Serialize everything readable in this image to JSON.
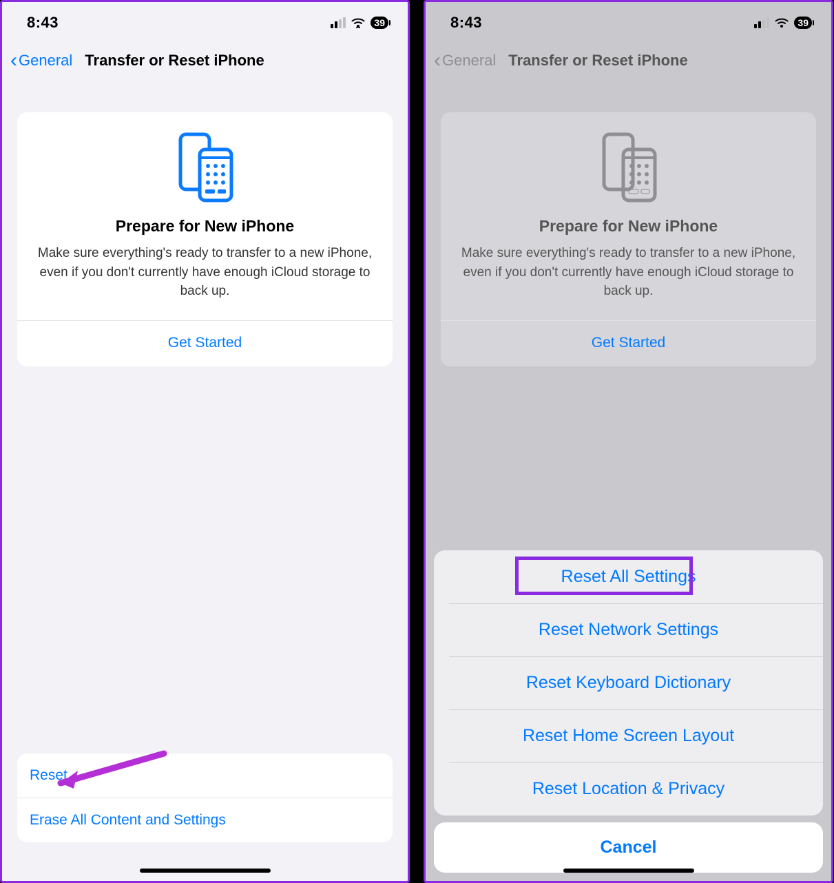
{
  "status": {
    "time": "8:43",
    "battery": "39"
  },
  "nav": {
    "back": "General",
    "title": "Transfer or Reset iPhone"
  },
  "card": {
    "title": "Prepare for New iPhone",
    "desc": "Make sure everything's ready to transfer to a new iPhone, even if you don't currently have enough iCloud storage to back up.",
    "cta": "Get Started"
  },
  "bottom": {
    "reset": "Reset",
    "erase": "Erase All Content and Settings"
  },
  "sheet": {
    "items": [
      "Reset All Settings",
      "Reset Network Settings",
      "Reset Keyboard Dictionary",
      "Reset Home Screen Layout",
      "Reset Location & Privacy"
    ],
    "cancel": "Cancel"
  }
}
